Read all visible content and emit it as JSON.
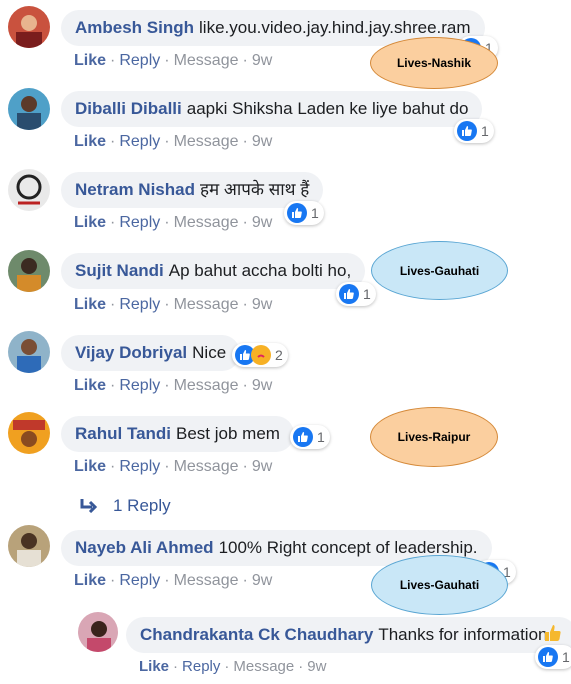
{
  "comments": [
    {
      "author": "Ambesh Singh",
      "text": "like.you.video.jay.hind.jay.shree.ram",
      "like": "Like",
      "reply": "Reply",
      "message": "Message",
      "time": "9w",
      "reactions": "1"
    },
    {
      "author": "Diballi Diballi",
      "text": "aapki Shiksha Laden ke liye bahut do",
      "like": "Like",
      "reply": "Reply",
      "message": "Message",
      "time": "9w",
      "reactions": "1"
    },
    {
      "author": "Netram Nishad",
      "text": "हम आपके साथ हैं",
      "like": "Like",
      "reply": "Reply",
      "message": "Message",
      "time": "9w",
      "reactions": "1"
    },
    {
      "author": "Sujit Nandi",
      "text": "Ap bahut accha bolti ho,",
      "like": "Like",
      "reply": "Reply",
      "message": "Message",
      "time": "9w",
      "reactions": "1"
    },
    {
      "author": "Vijay Dobriyal",
      "text": "Nice",
      "like": "Like",
      "reply": "Reply",
      "message": "Message",
      "time": "9w",
      "reactions": "2"
    },
    {
      "author": "Rahul Tandi",
      "text": "Best job mem",
      "like": "Like",
      "reply": "Reply",
      "message": "Message",
      "time": "9w",
      "reactions": "1"
    },
    {
      "author": "Nayeb Ali Ahmed",
      "text": "100% Right concept of leadership.",
      "like": "Like",
      "reply": "Reply",
      "message": "Message",
      "time": "9w",
      "reactions": "1"
    }
  ],
  "replies_link": "1 Reply",
  "nested_reply": {
    "author": "Chandrakanta Ck Chaudhary",
    "text": "Thanks for information",
    "like": "Like",
    "reply": "Reply",
    "message": "Message",
    "time": "9w",
    "reactions": "1"
  },
  "annotations": [
    "Lives-Nashik",
    "Lives-Gauhati",
    "Lives-Raipur",
    "Lives-Gauhati"
  ],
  "separator": "·",
  "colors": {
    "name": "#385898",
    "action": "#4b67a1",
    "muted": "#90949c",
    "bubble": "#f0f2f5",
    "like_blue": "#1877f2",
    "oval_orange": "#fbcf9f",
    "oval_blue": "#c9e7f7"
  }
}
